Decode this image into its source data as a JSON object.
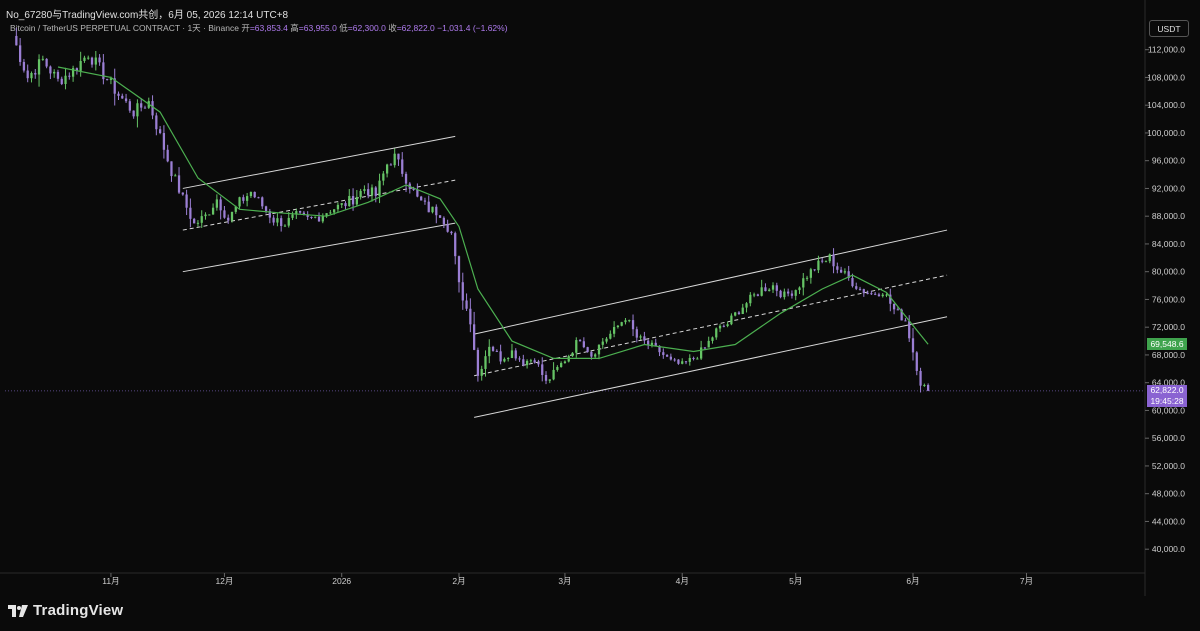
{
  "header": {
    "title": "No_67280与TradingView.com共创，6月 05, 2026 12:14 UTC+8",
    "symbol": "Bitcoin / TetherUS PERPETUAL CONTRACT · 1天 · Binance",
    "open_label": "开",
    "open": "=63,853.4",
    "high_label": "高",
    "high": "=63,955.0",
    "low_label": "低",
    "low": "=62,300.0",
    "close_label": "收",
    "close": "=62,822.0",
    "change": "−1,031.4 (−1.62%)"
  },
  "currency": "USDT",
  "price_tags": {
    "ma_value": "69,548.6",
    "last_price": "62,822.0",
    "countdown": "19:45:28"
  },
  "footer": {
    "brand": "TradingView"
  },
  "colors": {
    "background": "#0a0a0a",
    "candle_up": "#66c466",
    "candle_down": "#9b7fd4",
    "ma_line": "#4caf50",
    "channel": "#d8d8d8",
    "last_price_tag": "#8a63d2",
    "ma_tag": "#3fa34d"
  },
  "chart_data": {
    "type": "candlestick",
    "title": "Bitcoin / TetherUS PERPETUAL CONTRACT · 1天 · Binance",
    "interval": "1天",
    "yaxis_ticks": [
      "112,000.0",
      "108,000.0",
      "104,000.0",
      "100,000.0",
      "96,000.0",
      "92,000.0",
      "88,000.0",
      "84,000.0",
      "80,000.0",
      "76,000.0",
      "72,000.0",
      "68,000.0",
      "64,000.0",
      "60,000.0",
      "56,000.0",
      "52,000.0",
      "48,000.0",
      "44,000.0",
      "40,000.0"
    ],
    "ylim": [
      37000,
      117000
    ],
    "xaxis_ticks": [
      "11月",
      "12月",
      "2026",
      "2月",
      "3月",
      "4月",
      "5月",
      "6月",
      "7月"
    ],
    "x_tick_dates": [
      "2025-11-01",
      "2025-12-01",
      "2026-01-01",
      "2026-02-01",
      "2026-03-01",
      "2026-04-01",
      "2026-05-01",
      "2026-06-01",
      "2026-07-01"
    ],
    "xlim": [
      "2025-10-04",
      "2026-07-31"
    ],
    "series": [
      {
        "name": "close",
        "points": [
          [
            "2025-10-06",
            114000
          ],
          [
            "2025-10-10",
            108000
          ],
          [
            "2025-10-14",
            110500
          ],
          [
            "2025-10-18",
            107500
          ],
          [
            "2025-10-22",
            109000
          ],
          [
            "2025-10-26",
            111500
          ],
          [
            "2025-10-30",
            108500
          ],
          [
            "2025-11-03",
            105500
          ],
          [
            "2025-11-07",
            103000
          ],
          [
            "2025-11-11",
            104500
          ],
          [
            "2025-11-14",
            99500
          ],
          [
            "2025-11-17",
            94500
          ],
          [
            "2025-11-20",
            90500
          ],
          [
            "2025-11-23",
            86800
          ],
          [
            "2025-11-26",
            88000
          ],
          [
            "2025-11-29",
            90500
          ],
          [
            "2025-12-02",
            87500
          ],
          [
            "2025-12-05",
            90000
          ],
          [
            "2025-12-08",
            91500
          ],
          [
            "2025-12-11",
            89500
          ],
          [
            "2025-12-14",
            87500
          ],
          [
            "2025-12-17",
            87000
          ],
          [
            "2025-12-20",
            88000
          ],
          [
            "2025-12-23",
            87500
          ],
          [
            "2025-12-26",
            88000
          ],
          [
            "2025-12-29",
            89000
          ],
          [
            "2026-01-01",
            89500
          ],
          [
            "2026-01-04",
            90500
          ],
          [
            "2026-01-07",
            92000
          ],
          [
            "2026-01-10",
            91000
          ],
          [
            "2026-01-13",
            95500
          ],
          [
            "2026-01-15",
            96500
          ],
          [
            "2026-01-18",
            93500
          ],
          [
            "2026-01-21",
            90500
          ],
          [
            "2026-01-24",
            89000
          ],
          [
            "2026-01-27",
            88500
          ],
          [
            "2026-01-30",
            85500
          ],
          [
            "2026-02-01",
            78000
          ],
          [
            "2026-02-04",
            73000
          ],
          [
            "2026-02-06",
            65000
          ],
          [
            "2026-02-09",
            69500
          ],
          [
            "2026-02-12",
            67500
          ],
          [
            "2026-02-15",
            68500
          ],
          [
            "2026-02-18",
            67000
          ],
          [
            "2026-02-21",
            67500
          ],
          [
            "2026-02-24",
            64000
          ],
          [
            "2026-02-27",
            66000
          ],
          [
            "2026-03-02",
            68000
          ],
          [
            "2026-03-05",
            70500
          ],
          [
            "2026-03-08",
            68000
          ],
          [
            "2026-03-11",
            70000
          ],
          [
            "2026-03-14",
            71500
          ],
          [
            "2026-03-17",
            73500
          ],
          [
            "2026-03-20",
            70500
          ],
          [
            "2026-03-23",
            69500
          ],
          [
            "2026-03-26",
            68500
          ],
          [
            "2026-03-29",
            67000
          ],
          [
            "2026-04-01",
            66500
          ],
          [
            "2026-04-04",
            67500
          ],
          [
            "2026-04-07",
            69000
          ],
          [
            "2026-04-10",
            71500
          ],
          [
            "2026-04-13",
            72500
          ],
          [
            "2026-04-16",
            74500
          ],
          [
            "2026-04-19",
            76000
          ],
          [
            "2026-04-22",
            77500
          ],
          [
            "2026-04-25",
            78000
          ],
          [
            "2026-04-28",
            76500
          ],
          [
            "2026-05-01",
            77500
          ],
          [
            "2026-05-04",
            79500
          ],
          [
            "2026-05-07",
            81000
          ],
          [
            "2026-05-10",
            82000
          ],
          [
            "2026-05-12",
            80500
          ],
          [
            "2026-05-15",
            79000
          ],
          [
            "2026-05-18",
            77500
          ],
          [
            "2026-05-21",
            76800
          ],
          [
            "2026-05-24",
            77300
          ],
          [
            "2026-05-27",
            74500
          ],
          [
            "2026-05-30",
            73000
          ],
          [
            "2026-06-01",
            68500
          ],
          [
            "2026-06-03",
            64000
          ],
          [
            "2026-06-05",
            62822
          ]
        ]
      },
      {
        "name": "MA",
        "points": [
          [
            "2025-10-18",
            109500
          ],
          [
            "2025-11-01",
            108000
          ],
          [
            "2025-11-14",
            103000
          ],
          [
            "2025-11-24",
            93500
          ],
          [
            "2025-12-05",
            89000
          ],
          [
            "2025-12-15",
            88500
          ],
          [
            "2025-12-28",
            88000
          ],
          [
            "2026-01-08",
            90000
          ],
          [
            "2026-01-18",
            92500
          ],
          [
            "2026-01-27",
            90500
          ],
          [
            "2026-02-01",
            86500
          ],
          [
            "2026-02-06",
            77500
          ],
          [
            "2026-02-15",
            70000
          ],
          [
            "2026-02-26",
            67500
          ],
          [
            "2026-03-10",
            67500
          ],
          [
            "2026-03-22",
            69500
          ],
          [
            "2026-04-04",
            68500
          ],
          [
            "2026-04-15",
            69500
          ],
          [
            "2026-04-27",
            74000
          ],
          [
            "2026-05-08",
            77500
          ],
          [
            "2026-05-16",
            79500
          ],
          [
            "2026-05-25",
            77000
          ],
          [
            "2026-06-05",
            69548.6
          ]
        ]
      }
    ],
    "channels": [
      {
        "upper": [
          [
            "2025-11-20",
            92000
          ],
          [
            "2026-01-31",
            99500
          ]
        ],
        "middle": [
          [
            "2025-11-20",
            86000
          ],
          [
            "2026-01-31",
            93200
          ]
        ],
        "lower": [
          [
            "2025-11-20",
            80000
          ],
          [
            "2026-01-31",
            87000
          ]
        ]
      },
      {
        "upper": [
          [
            "2026-02-05",
            71000
          ],
          [
            "2026-06-10",
            86000
          ]
        ],
        "middle": [
          [
            "2026-02-05",
            65000
          ],
          [
            "2026-06-10",
            79500
          ]
        ],
        "lower": [
          [
            "2026-02-05",
            59000
          ],
          [
            "2026-06-10",
            73500
          ]
        ]
      }
    ],
    "last_price": 62822.0,
    "ma_last": 69548.6,
    "grid": false,
    "legend_position": "top-left"
  }
}
